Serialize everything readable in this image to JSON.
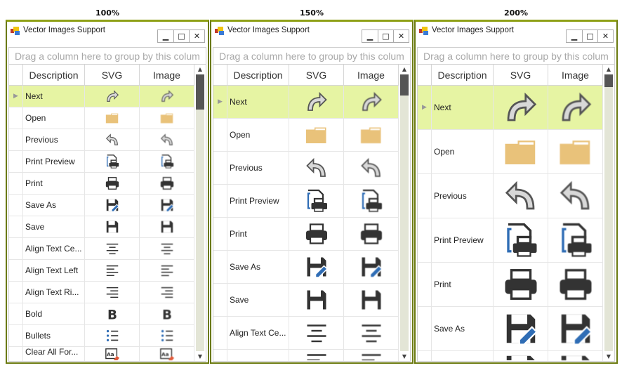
{
  "colors": {
    "accent": "#8fa017",
    "selected_row": "#e6f4a3",
    "folder": "#e9c27a",
    "blue": "#2f6db5",
    "eraser": "#e05a3a"
  },
  "panels": [
    {
      "zoom_label": "100%",
      "title": "Vector Images Support",
      "group_text": "Drag a column here to group by this colum",
      "columns": [
        "Description",
        "SVG",
        "Image"
      ],
      "row_height": 31,
      "icon_size": 22,
      "scroll_fraction": 0.0,
      "rows": [
        {
          "description": "Next",
          "icon": "next"
        },
        {
          "description": "Open",
          "icon": "open"
        },
        {
          "description": "Previous",
          "icon": "previous"
        },
        {
          "description": "Print Preview",
          "icon": "print-preview"
        },
        {
          "description": "Print",
          "icon": "print"
        },
        {
          "description": "Save As",
          "icon": "save-as"
        },
        {
          "description": "Save",
          "icon": "save"
        },
        {
          "description": "Align Text Ce...",
          "icon": "align-center"
        },
        {
          "description": "Align Text Left",
          "icon": "align-left"
        },
        {
          "description": "Align Text Ri...",
          "icon": "align-right"
        },
        {
          "description": "Bold",
          "icon": "bold"
        },
        {
          "description": "Bullets",
          "icon": "bullets"
        },
        {
          "description": "Clear All For...",
          "icon": "clear-format"
        }
      ]
    },
    {
      "zoom_label": "150%",
      "title": "Vector Images Support",
      "group_text": "Drag a column here to group by this colum",
      "columns": [
        "Description",
        "SVG",
        "Image"
      ],
      "row_height": 47,
      "icon_size": 36,
      "scroll_fraction": 0.0,
      "rows": [
        {
          "description": "Next",
          "icon": "next"
        },
        {
          "description": "Open",
          "icon": "open"
        },
        {
          "description": "Previous",
          "icon": "previous"
        },
        {
          "description": "Print Preview",
          "icon": "print-preview"
        },
        {
          "description": "Print",
          "icon": "print"
        },
        {
          "description": "Save As",
          "icon": "save-as"
        },
        {
          "description": "Save",
          "icon": "save"
        },
        {
          "description": "Align Text Ce...",
          "icon": "align-center"
        },
        {
          "description": "",
          "icon": "align-left"
        }
      ]
    },
    {
      "zoom_label": "200%",
      "title": "Vector Images Support",
      "group_text": "Drag a column here to group by this colum",
      "columns": [
        "Description",
        "SVG",
        "Image"
      ],
      "row_height": 63,
      "icon_size": 54,
      "scroll_fraction": 0.0,
      "rows": [
        {
          "description": "Next",
          "icon": "next"
        },
        {
          "description": "Open",
          "icon": "open"
        },
        {
          "description": "Previous",
          "icon": "previous"
        },
        {
          "description": "Print Preview",
          "icon": "print-preview"
        },
        {
          "description": "Print",
          "icon": "print"
        },
        {
          "description": "Save As",
          "icon": "save-as"
        },
        {
          "description": "",
          "icon": "save"
        }
      ]
    }
  ],
  "window_buttons": {
    "minimize": "▁",
    "maximize": "□",
    "close": "✕"
  }
}
